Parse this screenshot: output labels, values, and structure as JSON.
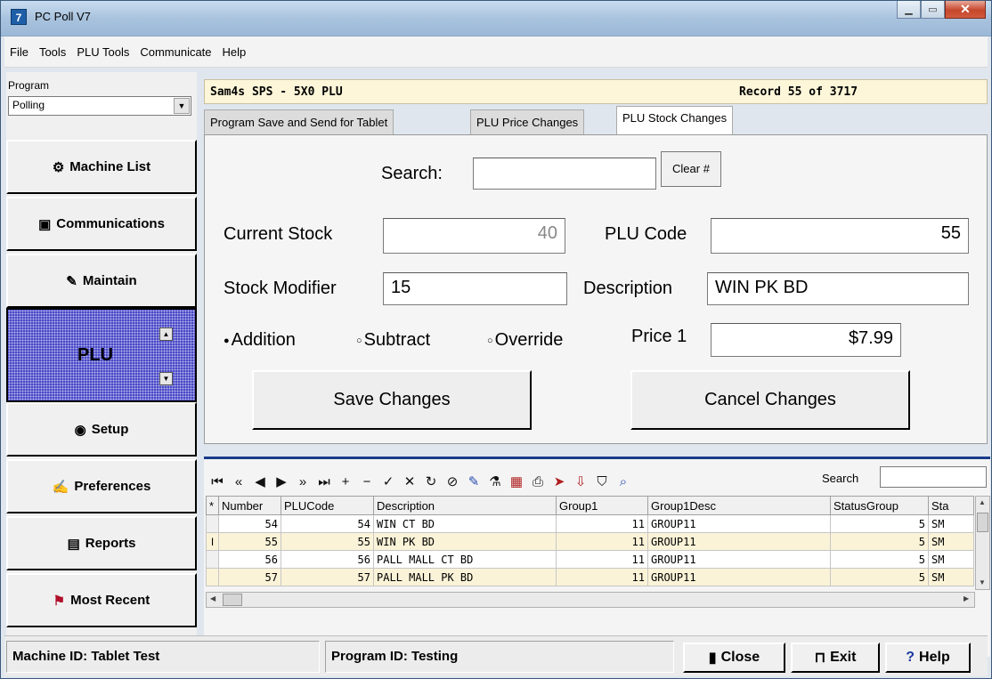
{
  "window": {
    "title": "PC Poll V7",
    "app_icon": "7"
  },
  "menu": [
    "File",
    "Tools",
    "PLU Tools",
    "Communicate",
    "Help"
  ],
  "program": {
    "label": "Program",
    "selected": "Polling"
  },
  "nav": [
    {
      "label": "Machine List",
      "icon": "gear-icon"
    },
    {
      "label": "Communications",
      "icon": "network-icon"
    },
    {
      "label": "Maintain",
      "icon": "wrench-icon"
    },
    {
      "label": "Setup",
      "icon": "globe-icon"
    },
    {
      "label": "Preferences",
      "icon": "pen-icon"
    },
    {
      "label": "Reports",
      "icon": "report-icon"
    },
    {
      "label": "Most Recent",
      "icon": "flag-icon"
    }
  ],
  "plu_panel": {
    "label": "PLU"
  },
  "header": {
    "left": "Sam4s SPS - 5X0 PLU",
    "right": "Record 55 of 3717"
  },
  "tabs": [
    "Program Save and Send for Tablet",
    "PLU Price Changes",
    "PLU Stock Changes"
  ],
  "form": {
    "search_label": "Search:",
    "search_value": "",
    "clear_label": "Clear #",
    "current_stock_label": "Current Stock",
    "current_stock": "40",
    "plu_code_label": "PLU Code",
    "plu_code": "55",
    "stock_modifier_label": "Stock Modifier",
    "stock_modifier": "15",
    "description_label": "Description",
    "description": "WIN PK BD",
    "radio_addition": "Addition",
    "radio_subtract": "Subtract",
    "radio_override": "Override",
    "radio_selected": "Addition",
    "price_label": "Price 1",
    "price": "$7.99",
    "save_label": "Save Changes",
    "cancel_label": "Cancel Changes"
  },
  "toolbar": {
    "search_label": "Search"
  },
  "grid": {
    "columns": [
      "*",
      "Number",
      "PLUCode",
      "Description",
      "Group1",
      "Group1Desc",
      "StatusGroup",
      "Sta"
    ],
    "rows": [
      [
        "",
        "54",
        "54",
        "WIN CT BD",
        "11",
        "GROUP11",
        "5",
        "SM"
      ],
      [
        "I",
        "55",
        "55",
        "WIN PK BD",
        "11",
        "GROUP11",
        "5",
        "SM"
      ],
      [
        "",
        "56",
        "56",
        "PALL MALL CT BD",
        "11",
        "GROUP11",
        "5",
        "SM"
      ],
      [
        "",
        "57",
        "57",
        "PALL MALL PK BD",
        "11",
        "GROUP11",
        "5",
        "SM"
      ]
    ]
  },
  "status": {
    "machine": "Machine ID: Tablet Test",
    "program": "Program ID: Testing",
    "close_label": "Close",
    "exit_label": "Exit",
    "help_label": "Help"
  }
}
